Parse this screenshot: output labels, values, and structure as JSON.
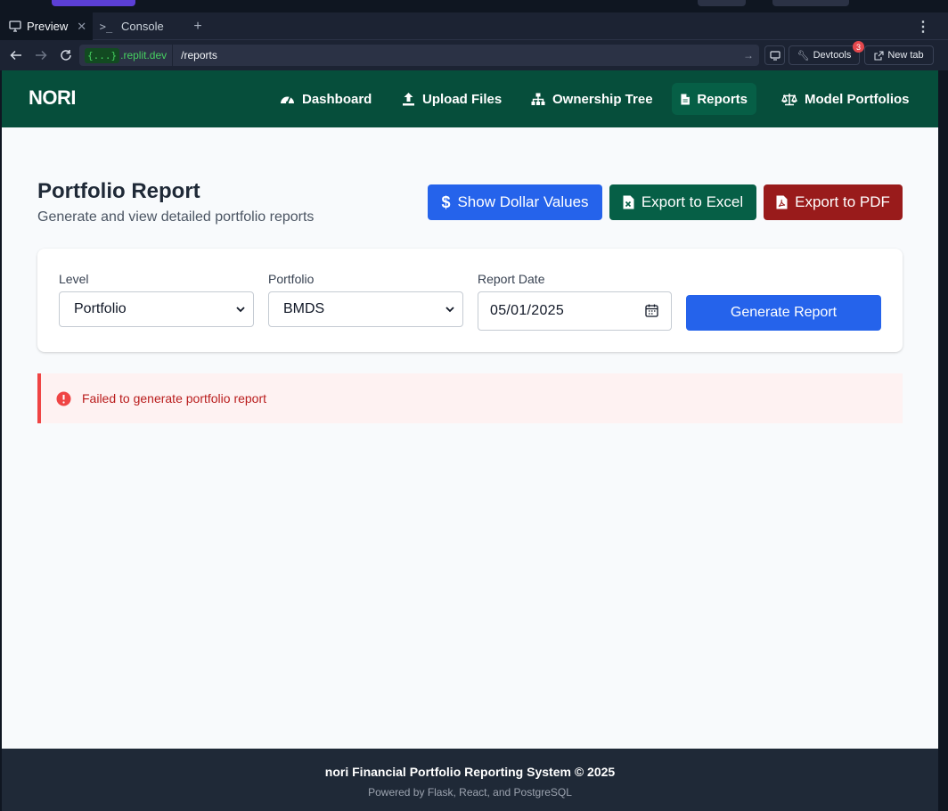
{
  "browser": {
    "tabs": [
      {
        "label": "Preview",
        "icon": "monitor-icon",
        "active": true
      },
      {
        "label": "Console",
        "icon": "terminal-prompt-icon",
        "active": false
      }
    ],
    "new_tab_symbol": "+",
    "menu_symbol": "⋮",
    "address": {
      "host_badge": "{...}",
      "host": ".replit.dev",
      "path": "/reports"
    },
    "devtools_label": "Devtools",
    "devtools_badge": "3",
    "new_tab_label": "New tab"
  },
  "app": {
    "brand": "NORI",
    "nav": [
      {
        "label": "Dashboard",
        "icon": "gauge-icon",
        "active": false
      },
      {
        "label": "Upload Files",
        "icon": "upload-icon",
        "active": false
      },
      {
        "label": "Ownership Tree",
        "icon": "sitemap-icon",
        "active": false
      },
      {
        "label": "Reports",
        "icon": "file-icon",
        "active": true
      },
      {
        "label": "Model Portfolios",
        "icon": "scale-icon",
        "active": false
      }
    ],
    "page": {
      "title": "Portfolio Report",
      "subtitle": "Generate and view detailed portfolio reports"
    },
    "actions": {
      "show_dollar": "Show Dollar Values",
      "export_excel": "Export to Excel",
      "export_pdf": "Export to PDF"
    },
    "filters": {
      "level_label": "Level",
      "level_value": "Portfolio",
      "portfolio_label": "Portfolio",
      "portfolio_value": "BMDS",
      "date_label": "Report Date",
      "date_value": "05/01/2025",
      "generate_label": "Generate Report"
    },
    "alert": {
      "message": "Failed to generate portfolio report"
    },
    "footer": {
      "line1": "nori Financial Portfolio Reporting System © 2025",
      "line2": "Powered by Flask, React, and PostgreSQL"
    }
  },
  "colors": {
    "nav_green": "#064e3b",
    "primary_blue": "#2563eb",
    "excel_green": "#065f46",
    "pdf_red": "#991b1b",
    "error_red": "#ef4444",
    "footer_dark": "#1f2937"
  }
}
